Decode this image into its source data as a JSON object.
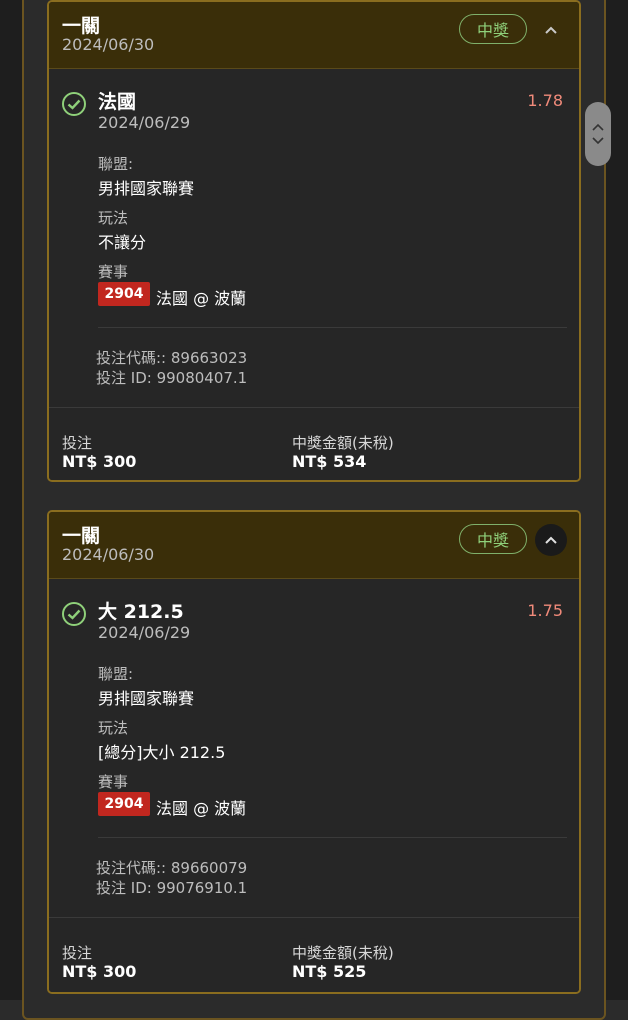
{
  "bets": [
    {
      "title": "一關",
      "date": "2024/06/30",
      "status": "中獎",
      "pick": "法國",
      "pick_date": "2024/06/29",
      "odds": "1.78",
      "league_label": "聯盟:",
      "league": "男排國家聯賽",
      "market_label": "玩法",
      "market": "不讓分",
      "event_label": "賽事",
      "event_id": "2904",
      "event_name": "法國 @ 波蘭",
      "bet_code": "投注代碼:: 89663023",
      "bet_id": "投注 ID: 99080407.1",
      "stake_label": "投注",
      "stake": "NT$ 300",
      "payout_label": "中獎金額(未稅)",
      "payout": "NT$ 534"
    },
    {
      "title": "一關",
      "date": "2024/06/30",
      "status": "中獎",
      "pick": "大 212.5",
      "pick_date": "2024/06/29",
      "odds": "1.75",
      "league_label": "聯盟:",
      "league": "男排國家聯賽",
      "market_label": "玩法",
      "market": "[總分]大小 212.5",
      "event_label": "賽事",
      "event_id": "2904",
      "event_name": "法國 @ 波蘭",
      "bet_code": "投注代碼:: 89660079",
      "bet_id": "投注 ID: 99076910.1",
      "stake_label": "投注",
      "stake": "NT$ 300",
      "payout_label": "中獎金額(未稅)",
      "payout": "NT$ 525"
    }
  ],
  "colors": {
    "accent_border": "#8a6d1f",
    "header_bg": "#3a2e09",
    "win_green": "#8fd07a",
    "odds_red": "#f08a7a",
    "event_badge": "#c1271f"
  },
  "icons": {
    "status": "check-circle-icon",
    "collapse": "chevron-up-icon",
    "scroll_up": "chevron-up-icon",
    "scroll_down": "chevron-down-icon"
  }
}
